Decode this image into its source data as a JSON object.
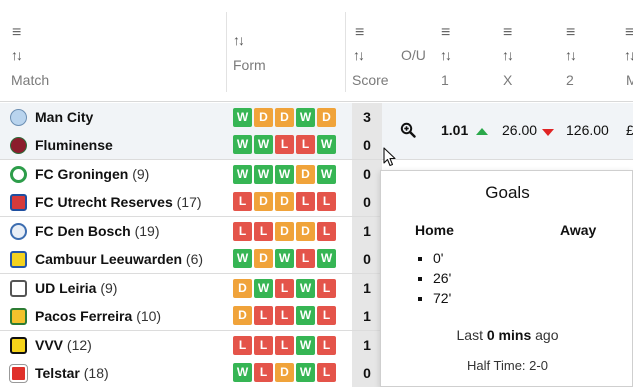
{
  "header": {
    "match_label": "Match",
    "form_label": "Form",
    "score_label": "Score",
    "ou_label": "O/U",
    "col1_label": "1",
    "colx_label": "X",
    "col2_label": "2",
    "col_cut_label": "M",
    "menu_glyph": "≡",
    "sort_glyph": "↑↓"
  },
  "matches": [
    {
      "home": {
        "name": "Man City",
        "pos": ""
      },
      "away": {
        "name": "Fluminense",
        "pos": ""
      },
      "home_form": [
        "W",
        "D",
        "D",
        "W",
        "D"
      ],
      "away_form": [
        "W",
        "W",
        "L",
        "L",
        "W"
      ],
      "home_score": "3",
      "away_score": "0",
      "odds": {
        "one": "1.01",
        "x": "26.00",
        "two": "126.00",
        "cut": "£"
      }
    },
    {
      "home": {
        "name": "FC Groningen",
        "pos": "(9)"
      },
      "away": {
        "name": "FC Utrecht Reserves",
        "pos": "(17)"
      },
      "home_form": [
        "W",
        "W",
        "W",
        "D",
        "W"
      ],
      "away_form": [
        "L",
        "D",
        "D",
        "L",
        "L"
      ],
      "home_score": "0",
      "away_score": "0"
    },
    {
      "home": {
        "name": "FC Den Bosch",
        "pos": "(19)"
      },
      "away": {
        "name": "Cambuur Leeuwarden",
        "pos": "(6)"
      },
      "home_form": [
        "L",
        "L",
        "D",
        "D",
        "L"
      ],
      "away_form": [
        "W",
        "D",
        "W",
        "L",
        "W"
      ],
      "home_score": "1",
      "away_score": "0"
    },
    {
      "home": {
        "name": "UD Leiria",
        "pos": "(9)"
      },
      "away": {
        "name": "Pacos Ferreira",
        "pos": "(10)"
      },
      "home_form": [
        "D",
        "W",
        "L",
        "W",
        "L"
      ],
      "away_form": [
        "D",
        "L",
        "L",
        "W",
        "L"
      ],
      "home_score": "1",
      "away_score": "1"
    },
    {
      "home": {
        "name": "VVV",
        "pos": "(12)"
      },
      "away": {
        "name": "Telstar",
        "pos": "(18)"
      },
      "home_form": [
        "L",
        "L",
        "L",
        "W",
        "L"
      ],
      "away_form": [
        "W",
        "L",
        "D",
        "W",
        "L"
      ],
      "home_score": "1",
      "away_score": "0"
    }
  ],
  "popup": {
    "title": "Goals",
    "home_label": "Home",
    "away_label": "Away",
    "home_goals": [
      "0'",
      "26'",
      "72'"
    ],
    "last_prefix": "Last ",
    "last_value": "0 mins",
    "last_suffix": " ago",
    "half_time": "Half Time: 2-0"
  },
  "icons": {
    "zoom": "zoom-in-icon",
    "up": "arrow-up-icon",
    "down": "arrow-down-icon"
  },
  "colors": {
    "win": "#36b554",
    "draw": "#f0a33a",
    "loss": "#e4544a",
    "up": "#2aa84a",
    "down": "#e02424"
  }
}
